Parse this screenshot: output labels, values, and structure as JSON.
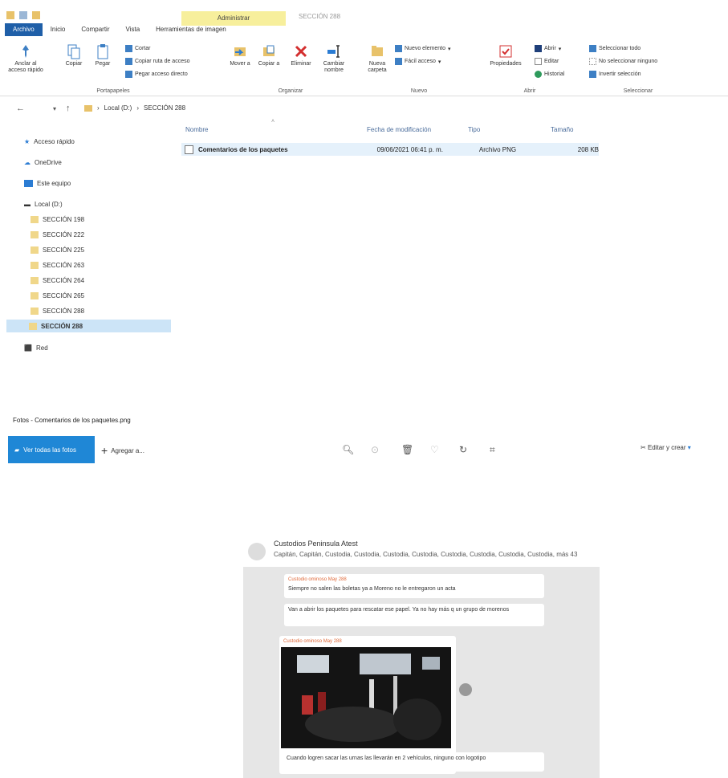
{
  "explorer": {
    "context_tab": "Administrar",
    "window_title": "SECCIÓN 288",
    "tabs": [
      "Archivo",
      "Inicio",
      "Compartir",
      "Vista",
      "Herramientas de imagen"
    ],
    "ribbon": {
      "portapapeles": {
        "pin": "Anclar al acceso rápido",
        "copy": "Copiar",
        "paste": "Pegar",
        "cut": "Cortar",
        "copy_path": "Copiar ruta de acceso",
        "paste_shortcut": "Pegar acceso directo",
        "group": "Portapapeles"
      },
      "organizar": {
        "move": "Mover a",
        "copy_to": "Copiar a",
        "delete": "Eliminar",
        "rename": "Cambiar nombre",
        "group": "Organizar"
      },
      "nuevo": {
        "new_folder": "Nueva carpeta",
        "new_item": "Nuevo elemento",
        "easy_access": "Fácil acceso",
        "group": "Nuevo"
      },
      "abrir": {
        "properties": "Propiedades",
        "open": "Abrir",
        "edit": "Editar",
        "history": "Historial",
        "group": "Abrir"
      },
      "seleccionar": {
        "select_all": "Seleccionar todo",
        "select_none": "No seleccionar ninguno",
        "invert": "Invertir selección",
        "group": "Seleccionar"
      }
    },
    "breadcrumb": [
      "Local (D:)",
      "SECCIÓN 288"
    ],
    "sidebar": {
      "quick_access": "Acceso rápido",
      "onedrive": "OneDrive",
      "this_pc": "Este equipo",
      "local": "Local (D:)",
      "folders": [
        "SECCIÓN 198",
        "SECCIÓN 222",
        "SECCIÓN 225",
        "SECCIÓN 263",
        "SECCIÓN 264",
        "SECCIÓN 265",
        "SECCIÓN 288",
        "SECCIÓN 288"
      ],
      "network": "Red"
    },
    "columns": [
      "Nombre",
      "Fecha de modificación",
      "Tipo",
      "Tamaño"
    ],
    "file": {
      "name": "Comentarios de los paquetes",
      "date": "09/06/2021 06:41 p. m.",
      "type": "Archivo PNG",
      "size": "208 KB"
    }
  },
  "photos": {
    "title": "Fotos - Comentarios de los paquetes.png",
    "see_all": "Ver todas las fotos",
    "add": "Agregar a...",
    "edit_create": "Editar y crear"
  },
  "chat": {
    "name": "Custodios Peninsula Atest",
    "members": "Capitán, Capitán, Custodia, Custodia, Custodia, Custodia, Custodia, Custodia, Custodia, Custodia, más 43",
    "messages": [
      {
        "author": "Custodio ominoso May 288",
        "text": "Siempre no salen las boletas ya a Moreno no le entregaron un acta"
      },
      {
        "author": "",
        "text": "Van a abrir los paquetes para rescatar ese papel. Ya no hay más q un grupo de morenos"
      },
      {
        "author": "Custodio ominoso May 288",
        "text": "Cuando logren sacar las urnas las llevarán en 2 vehículos, ninguno con logotipo"
      }
    ]
  }
}
